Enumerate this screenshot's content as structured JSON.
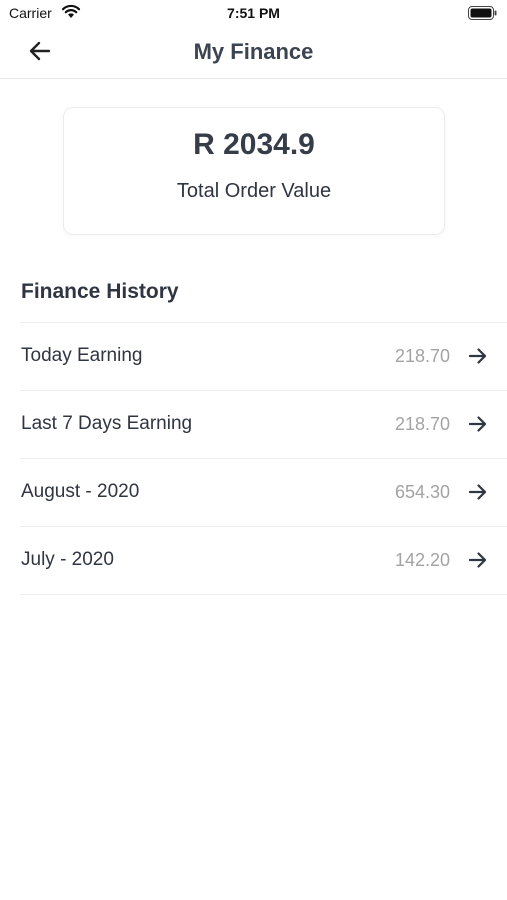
{
  "status_bar": {
    "carrier": "Carrier",
    "time": "7:51 PM",
    "wifi_icon": "wifi-icon",
    "battery_icon": "battery-icon"
  },
  "nav": {
    "back_icon": "arrow-left-icon",
    "title": "My Finance"
  },
  "summary": {
    "amount": "R 2034.9",
    "label": "Total Order Value"
  },
  "history": {
    "title": "Finance History",
    "row_icon": "arrow-right-icon",
    "items": [
      {
        "label": "Today Earning",
        "value": "218.70"
      },
      {
        "label": "Last 7 Days Earning",
        "value": "218.70"
      },
      {
        "label": "August - 2020",
        "value": "654.30"
      },
      {
        "label": "July - 2020",
        "value": "142.20"
      }
    ]
  },
  "colors": {
    "text_primary": "#2f3541",
    "text_secondary": "#a3a3a3",
    "divider": "#eeeeee",
    "background": "#ffffff"
  }
}
